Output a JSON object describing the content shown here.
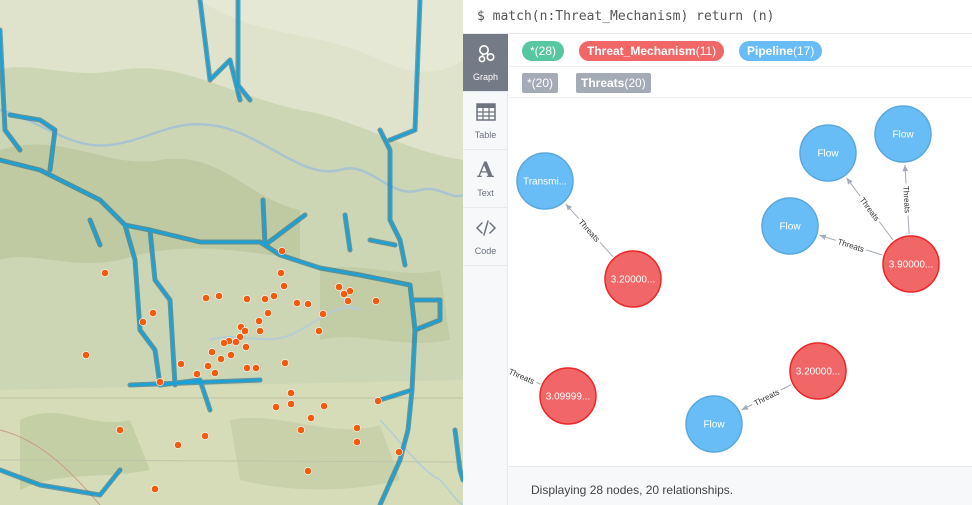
{
  "query": {
    "text": "$ match(n:Threat_Mechanism) return (n)"
  },
  "sidebar": {
    "tabs": [
      {
        "label": "Graph",
        "icon": "graph-icon",
        "active": true
      },
      {
        "label": "Table",
        "icon": "table-icon",
        "active": false
      },
      {
        "label": "Text",
        "icon": "text-icon",
        "active": false
      },
      {
        "label": "Code",
        "icon": "code-icon",
        "active": false
      }
    ]
  },
  "node_labels": [
    {
      "name": "*",
      "count": "(28)",
      "color": "#57c7a1"
    },
    {
      "name": "Threat_Mechanism",
      "count": "(11)",
      "color": "#f16667"
    },
    {
      "name": "Pipeline",
      "count": "(17)",
      "color": "#68bdf6"
    }
  ],
  "relationship_types": [
    {
      "name": "*",
      "count": "(20)"
    },
    {
      "name": "Threats",
      "count": "(20)"
    }
  ],
  "graph": {
    "nodes": [
      {
        "id": "n1",
        "label": "Transmi...",
        "kind": "Pipeline"
      },
      {
        "id": "n2",
        "label": "3.20000...",
        "kind": "Threat_Mechanism"
      },
      {
        "id": "n3",
        "label": "Flow",
        "kind": "Pipeline"
      },
      {
        "id": "n4",
        "label": "Flow",
        "kind": "Pipeline"
      },
      {
        "id": "n5",
        "label": "Flow",
        "kind": "Pipeline"
      },
      {
        "id": "n6",
        "label": "3.90000...",
        "kind": "Threat_Mechanism"
      },
      {
        "id": "n7",
        "label": "3.09999...",
        "kind": "Threat_Mechanism"
      },
      {
        "id": "n8",
        "label": "3.20000...",
        "kind": "Threat_Mechanism"
      },
      {
        "id": "n9",
        "label": "Flow",
        "kind": "Pipeline"
      }
    ],
    "relationships": [
      {
        "from": "n2",
        "to": "n1",
        "label": "Threats"
      },
      {
        "from": "n6",
        "to": "n3",
        "label": "Threats"
      },
      {
        "from": "n6",
        "to": "n4",
        "label": "Threats"
      },
      {
        "from": "n6",
        "to": "n5",
        "label": "Threats"
      },
      {
        "from": "n7",
        "to": "offscreen-left",
        "label": "Threats"
      },
      {
        "from": "n8",
        "to": "n9",
        "label": "Threats"
      }
    ]
  },
  "footer": {
    "text": "Displaying 28 nodes, 20 relationships."
  },
  "colors": {
    "pipeline_node": "#68bdf6",
    "pipeline_border": "#5ca8db",
    "threat_node": "#f16667",
    "threat_border": "#eb2728",
    "map_pipeline_line": "#1a95c9",
    "map_point": "#f25a0d",
    "map_base": "#c9d3b0"
  }
}
